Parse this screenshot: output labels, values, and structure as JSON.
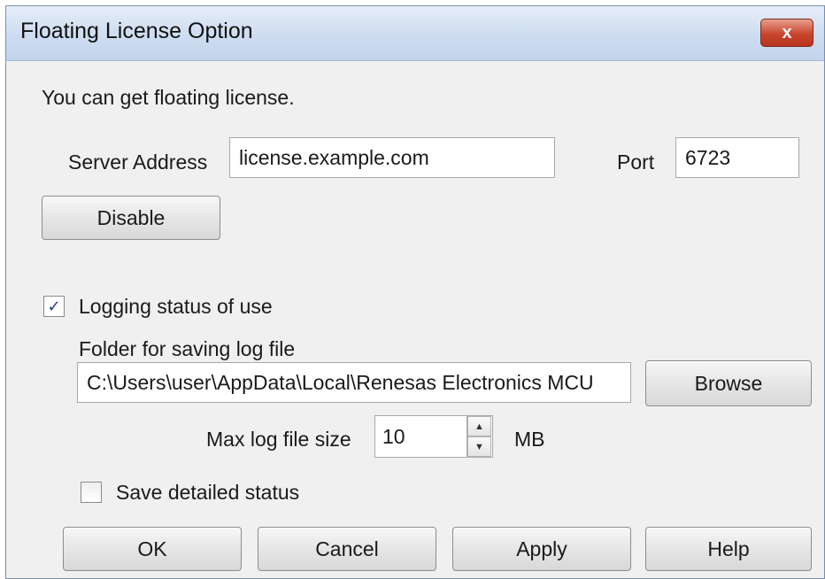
{
  "window": {
    "title": "Floating License Option",
    "close_glyph": "x"
  },
  "intro_text": "You can get floating license.",
  "server": {
    "address_label": "Server Address",
    "address_value": "license.example.com",
    "port_label": "Port",
    "port_value": "6723"
  },
  "disable_button": "Disable",
  "logging": {
    "checkbox_label": "Logging status of use",
    "checked": true,
    "folder_label": "Folder for saving log file",
    "folder_value": "C:\\Users\\user\\AppData\\Local\\Renesas Electronics MCU",
    "browse_button": "Browse",
    "max_size_label": "Max log file size",
    "max_size_value": "10",
    "max_size_unit": "MB"
  },
  "detailed": {
    "checkbox_label": "Save detailed status",
    "checked": false
  },
  "footer": {
    "ok": "OK",
    "cancel": "Cancel",
    "apply": "Apply",
    "help": "Help"
  },
  "icons": {
    "check": "check-icon",
    "spin_up": "arrow-up-icon",
    "spin_down": "arrow-down-icon",
    "close": "close-icon"
  }
}
